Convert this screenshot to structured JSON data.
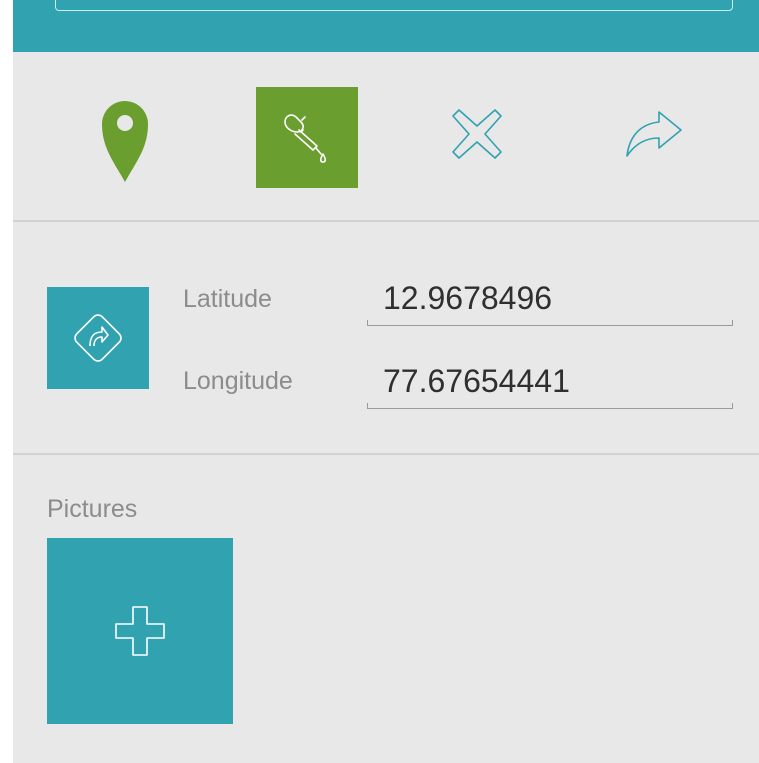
{
  "toolbar": {
    "icons": [
      "map-pin-icon",
      "eyedropper-icon",
      "close-icon",
      "share-arrow-icon"
    ],
    "selected": "eyedropper"
  },
  "location": {
    "latitude_label": "Latitude",
    "latitude_value": "12.9678496",
    "longitude_label": "Longitude",
    "longitude_value": "77.67654441"
  },
  "pictures": {
    "label": "Pictures"
  },
  "colors": {
    "teal": "#30a2b0",
    "green": "#6a9e2e",
    "background": "#e8e8e8",
    "label_gray": "#8c8c8c"
  }
}
